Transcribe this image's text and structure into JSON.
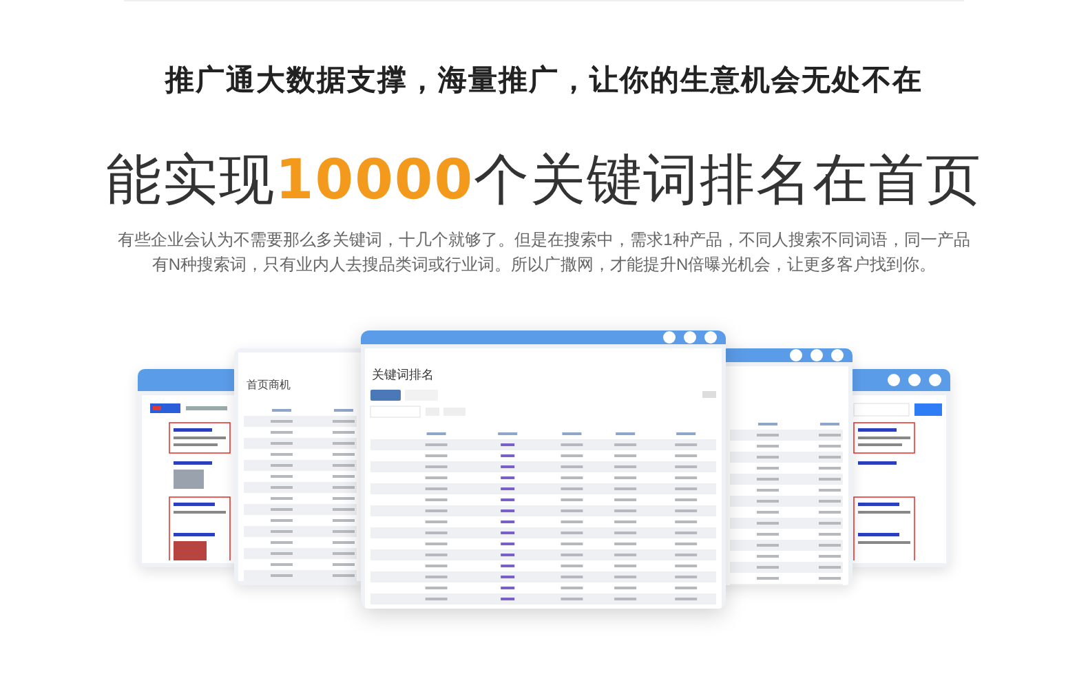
{
  "headline": "推广通大数据支撑，海量推广，让你的生意机会无处不在",
  "heading": {
    "before": "能实现",
    "highlight": "10000",
    "after": "个关键词排名在首页"
  },
  "description": [
    "有些企业会认为不需要那么多关键词，十几个就够了。但是在搜索中，需求1种产品，不同人搜索不同词语，同一产品",
    "有N种搜索词，只有业内人去搜品类词或行业词。所以广撒网，才能提升N倍曝光机会，让更多客户找到你。"
  ],
  "windows": [
    {
      "kind": "search"
    },
    {
      "kind": "table",
      "title": "首页商机"
    },
    {
      "kind": "main-table",
      "title": "关键词排名"
    },
    {
      "kind": "table"
    },
    {
      "kind": "search"
    }
  ]
}
